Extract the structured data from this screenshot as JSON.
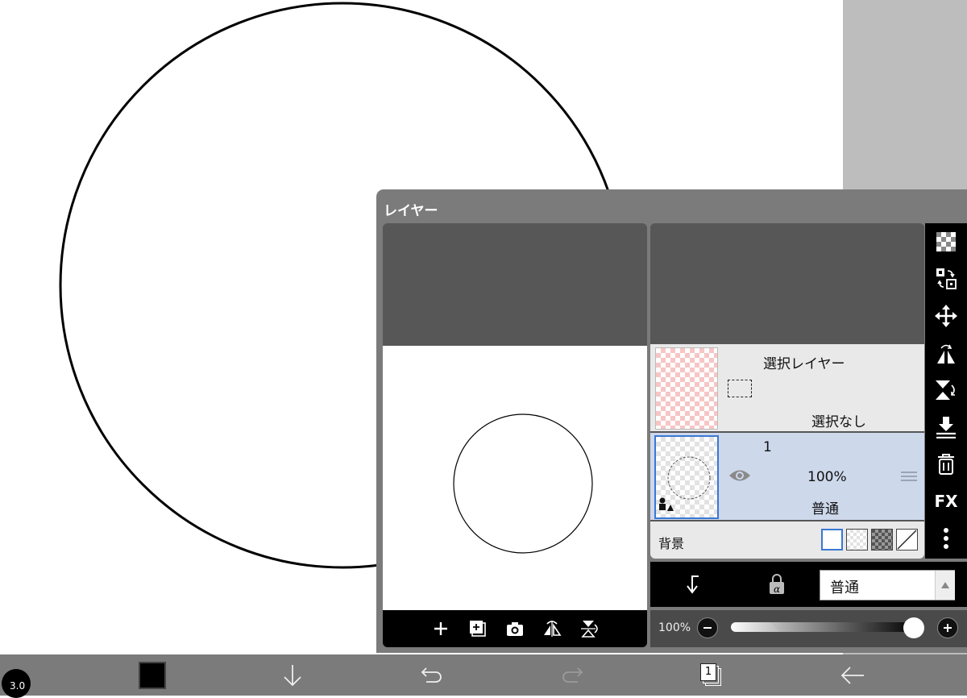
{
  "panel": {
    "title": "レイヤー"
  },
  "layers": {
    "selection_layer": {
      "name": "選択レイヤー",
      "status": "選択なし"
    },
    "layer1": {
      "name": "1",
      "opacity": "100%",
      "blend": "普通"
    },
    "background": {
      "label": "背景"
    }
  },
  "blend_mode": {
    "selected": "普通"
  },
  "opacity": {
    "label": "100%",
    "value": 1.0
  },
  "side_toolbar": {
    "fx_label": "FX"
  },
  "bottom_bar": {
    "brush_size": "3.0",
    "layer_count": "1"
  },
  "colors": {
    "accent": "#3a78d4",
    "panel": "#7b7b7b",
    "selected_row": "#cdd8eb",
    "toolbar": "#000000"
  }
}
